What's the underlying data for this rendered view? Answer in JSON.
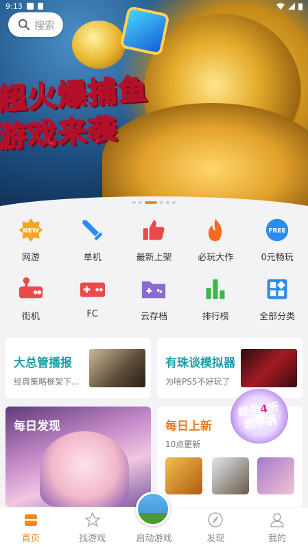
{
  "status_bar": {
    "time": "9:13"
  },
  "search": {
    "placeholder": "搜索"
  },
  "banner": {
    "title_line1": "超火爆捕鱼",
    "title_line2": "游戏来袭",
    "page_count": 6,
    "active_page": 3
  },
  "categories": [
    {
      "label": "网游",
      "icon": "new-badge-icon",
      "badge": "NEW"
    },
    {
      "label": "单机",
      "icon": "sword-icon"
    },
    {
      "label": "最新上架",
      "icon": "thumbs-up-icon"
    },
    {
      "label": "必玩大作",
      "icon": "flame-icon"
    },
    {
      "label": "0元畅玩",
      "icon": "free-badge-icon",
      "badge": "FREE"
    },
    {
      "label": "街机",
      "icon": "arcade-icon"
    },
    {
      "label": "FC",
      "icon": "gamepad-icon"
    },
    {
      "label": "云存档",
      "icon": "cloud-folder-icon"
    },
    {
      "label": "排行榜",
      "icon": "bar-chart-icon"
    },
    {
      "label": "全部分类",
      "icon": "grid-icon"
    }
  ],
  "cards": {
    "card1": {
      "title": "大总管播报",
      "subtitle": "经典策略框架下..."
    },
    "card2": {
      "title": "有珠谈模拟器",
      "subtitle": "为啥PS5不好玩了"
    },
    "card3": {
      "title": "每日发现"
    },
    "card4": {
      "title": "每日上新",
      "subtitle": "10点更新"
    }
  },
  "promo": {
    "line1": "终生4折",
    "line2": "送手柄"
  },
  "nav": {
    "home": "首页",
    "find_games": "找游戏",
    "launch": "启动游戏",
    "discover": "发现",
    "mine": "我的"
  },
  "colors": {
    "accent": "#f08a1e",
    "teal": "#1a9ea8",
    "red": "#ea4a4a",
    "blue": "#2a8cf0",
    "green": "#3bb84a",
    "purple": "#8b6ad0"
  }
}
